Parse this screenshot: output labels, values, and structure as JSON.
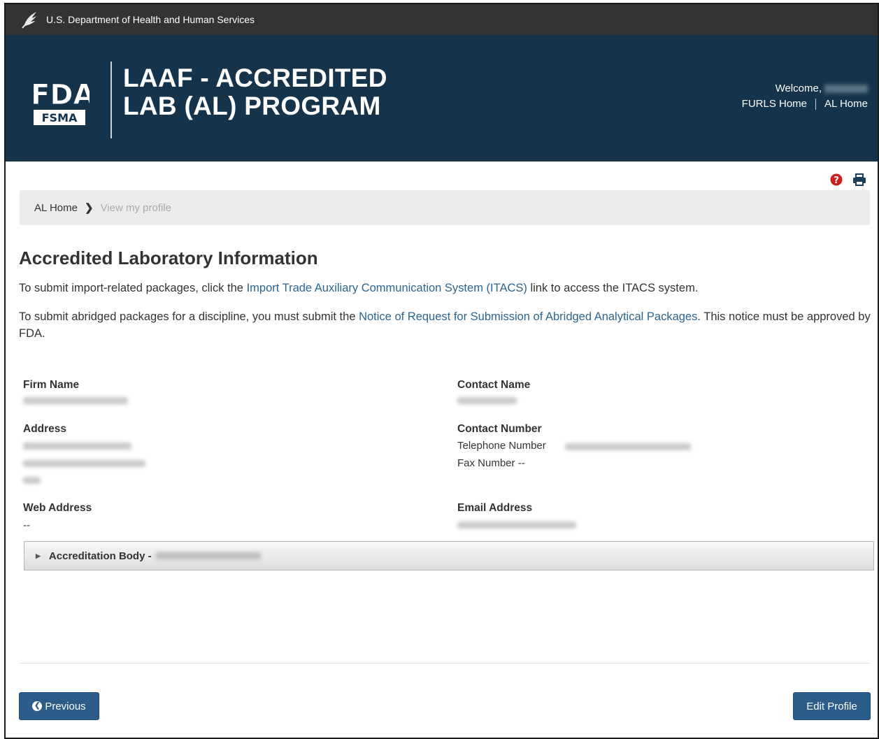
{
  "topbar": {
    "agency": "U.S. Department of Health and Human Services"
  },
  "banner": {
    "program_line1": "LAAF - ACCREDITED",
    "program_line2": "LAB (AL) PROGRAM",
    "logo_top": "FDA",
    "logo_bottom": "FSMA",
    "welcome": "Welcome,",
    "furls_home": "FURLS Home",
    "al_home": "AL Home"
  },
  "breadcrumb": {
    "home": "AL Home",
    "current": "View my profile"
  },
  "page": {
    "title": "Accredited Laboratory Information",
    "para1_before": "To submit import-related packages, click the ",
    "para1_link": "Import Trade Auxiliary Communication System (ITACS)",
    "para1_after": " link to access the ITACS system.",
    "para2_before": "To submit abridged packages for a discipline, you must submit the ",
    "para2_link": "Notice of Request for Submission of Abridged Analytical Packages",
    "para2_after": ". This notice must be approved by FDA."
  },
  "fields": {
    "firm_name_label": "Firm Name",
    "address_label": "Address",
    "web_address_label": "Web Address",
    "web_address_value": "--",
    "contact_name_label": "Contact Name",
    "contact_number_label": "Contact Number",
    "telephone_label": "Telephone Number",
    "fax_label": "Fax Number --",
    "email_label": "Email Address"
  },
  "accordion": {
    "label": "Accreditation Body -"
  },
  "buttons": {
    "previous": "Previous",
    "edit_profile": "Edit Profile"
  },
  "colors": {
    "banner": "#15334a",
    "topbar": "#333333",
    "link": "#2b6592",
    "button": "#2b5c8a",
    "help": "#cc1f1f"
  },
  "icons": [
    "hhs-eagle-icon",
    "fda-fsma-logo",
    "help-icon",
    "print-icon",
    "chevron-right-icon",
    "caret-right-icon",
    "chevron-left-circle-icon"
  ]
}
